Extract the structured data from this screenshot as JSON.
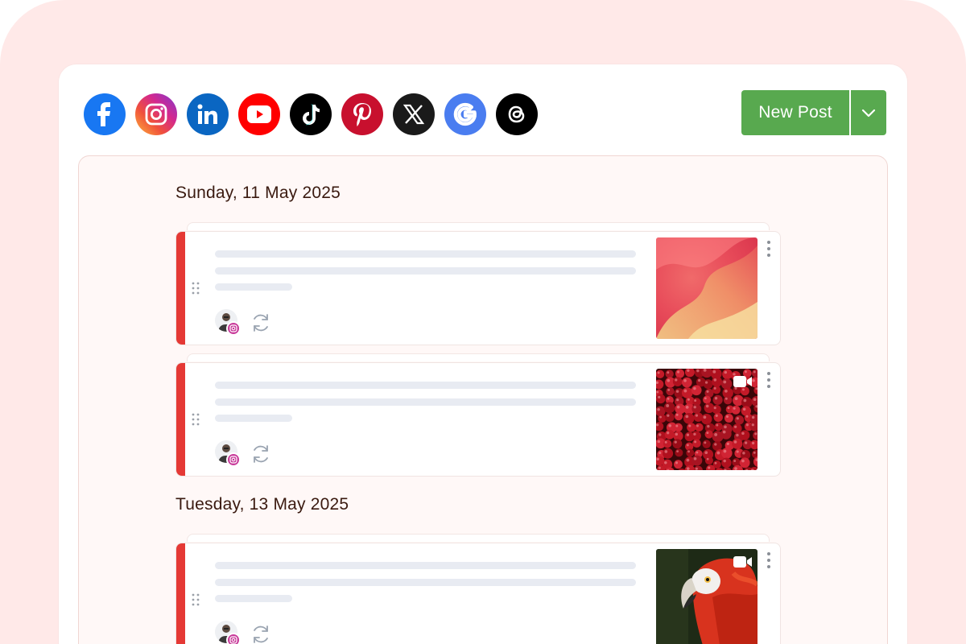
{
  "toolbar": {
    "new_post_label": "New Post",
    "new_post_color": "#58a94f",
    "social_networks": [
      {
        "name": "facebook",
        "icon": "facebook-icon",
        "color": "#1877f2"
      },
      {
        "name": "instagram",
        "icon": "instagram-icon",
        "color": "#e1306c"
      },
      {
        "name": "linkedin",
        "icon": "linkedin-icon",
        "color": "#0a66c2"
      },
      {
        "name": "youtube",
        "icon": "youtube-icon",
        "color": "#ff0000"
      },
      {
        "name": "tiktok",
        "icon": "tiktok-icon",
        "color": "#000000"
      },
      {
        "name": "pinterest",
        "icon": "pinterest-icon",
        "color": "#c8102e"
      },
      {
        "name": "x",
        "icon": "x-icon",
        "color": "#1a1a1a"
      },
      {
        "name": "google",
        "icon": "google-icon",
        "color": "#4285f4"
      },
      {
        "name": "threads",
        "icon": "threads-icon",
        "color": "#000000"
      }
    ]
  },
  "feed": {
    "groups": [
      {
        "date": "Sunday, 11 May 2025",
        "posts": [
          {
            "network": "instagram",
            "media": "abstract-red-image",
            "has_video": false,
            "status_color": "#e53935"
          },
          {
            "network": "instagram",
            "media": "cranberries-image",
            "has_video": true,
            "status_color": "#e53935"
          }
        ]
      },
      {
        "date": "Tuesday, 13 May 2025",
        "posts": [
          {
            "network": "instagram",
            "media": "parrot-image",
            "has_video": true,
            "status_color": "#e53935"
          }
        ]
      }
    ]
  }
}
